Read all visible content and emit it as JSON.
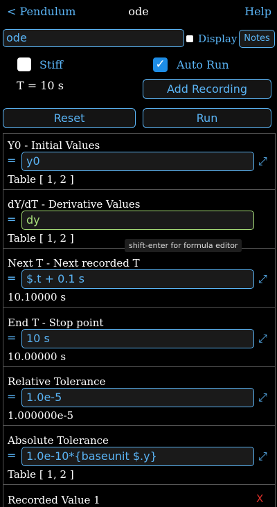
{
  "header": {
    "back_label": "< Pendulum",
    "title": "ode",
    "help_label": "Help"
  },
  "toolbar": {
    "name_value": "ode",
    "display_label": "Display",
    "notes_label": "Notes",
    "stiff_label": "Stiff",
    "auto_run_label": "Auto Run",
    "auto_run_check": "✓",
    "t_display": "T = 10 s",
    "add_recording_label": "Add Recording",
    "reset_label": "Reset",
    "run_label": "Run"
  },
  "sections": [
    {
      "title": "Y0 - Initial Values",
      "eq": "=",
      "formula": "y0",
      "value": "Table [ 1, 2 ]",
      "expand": "⤢"
    },
    {
      "title": "dY/dT - Derivative Values",
      "eq": "=",
      "formula": "dy",
      "value": "Table [ 1, 2 ]",
      "expand": ""
    },
    {
      "title": "Next T - Next recorded T",
      "eq": "=",
      "formula": "$.t + 0.1 s",
      "value": "10.10000 s",
      "expand": "⤢"
    },
    {
      "title": "End T - Stop point",
      "eq": "=",
      "formula": "10 s",
      "value": "10.00000 s",
      "expand": "⤢"
    },
    {
      "title": "Relative Tolerance",
      "eq": "=",
      "formula": "1.0e-5",
      "value": "1.000000e-5",
      "expand": "⤢"
    },
    {
      "title": "Absolute Tolerance",
      "eq": "=",
      "formula": "1.0e-10*{baseunit $.y}",
      "value": "Table [ 1, 2 ]",
      "expand": "⤢"
    }
  ],
  "tooltip": "shift-enter for formula editor",
  "partial_section": {
    "title": "Recorded Value 1",
    "remove": "X"
  },
  "colors": {
    "accent": "#5ab4f5",
    "active_field": "#a8e07a",
    "checkbox_checked": "#1e8de6",
    "remove": "#e0302a"
  }
}
